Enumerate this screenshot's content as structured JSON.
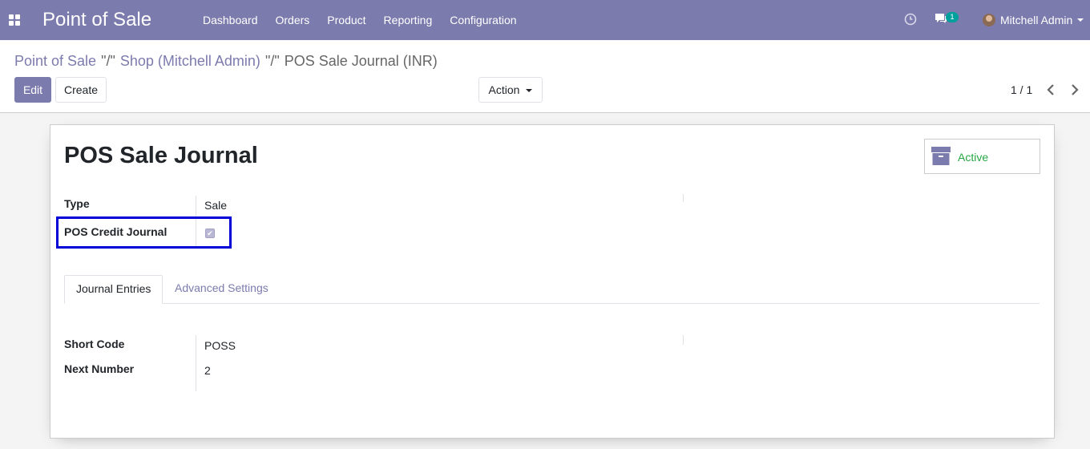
{
  "navbar": {
    "app_title": "Point of Sale",
    "menu": [
      "Dashboard",
      "Orders",
      "Product",
      "Reporting",
      "Configuration"
    ],
    "chat_badge": "1",
    "user_name": "Mitchell Admin",
    "accent_color": "#7c7bad"
  },
  "breadcrumb": {
    "root": "Point of Sale",
    "sep1": "\"/\"",
    "shop": "Shop (Mitchell Admin)",
    "sep2": "\"/\"",
    "current": "POS Sale Journal (INR)"
  },
  "toolbar": {
    "edit_label": "Edit",
    "create_label": "Create",
    "action_label": "Action"
  },
  "pager": {
    "value": "1 / 1"
  },
  "record": {
    "title": "POS Sale Journal",
    "active_label": "Active",
    "fields": {
      "type_label": "Type",
      "type_value": "Sale",
      "credit_label": "POS Credit Journal",
      "credit_checked": true
    }
  },
  "tabs": [
    "Journal Entries",
    "Advanced Settings"
  ],
  "journal_entries": {
    "short_code_label": "Short Code",
    "short_code_value": "POSS",
    "next_number_label": "Next Number",
    "next_number_value": "2"
  },
  "icons": [
    "apps-icon",
    "clock-icon",
    "chat-icon",
    "avatar",
    "chevron-left-icon",
    "chevron-right-icon",
    "archive-icon",
    "check-icon"
  ],
  "colors": {
    "active_status": "#28a745",
    "highlight_border": "#0000d6"
  }
}
